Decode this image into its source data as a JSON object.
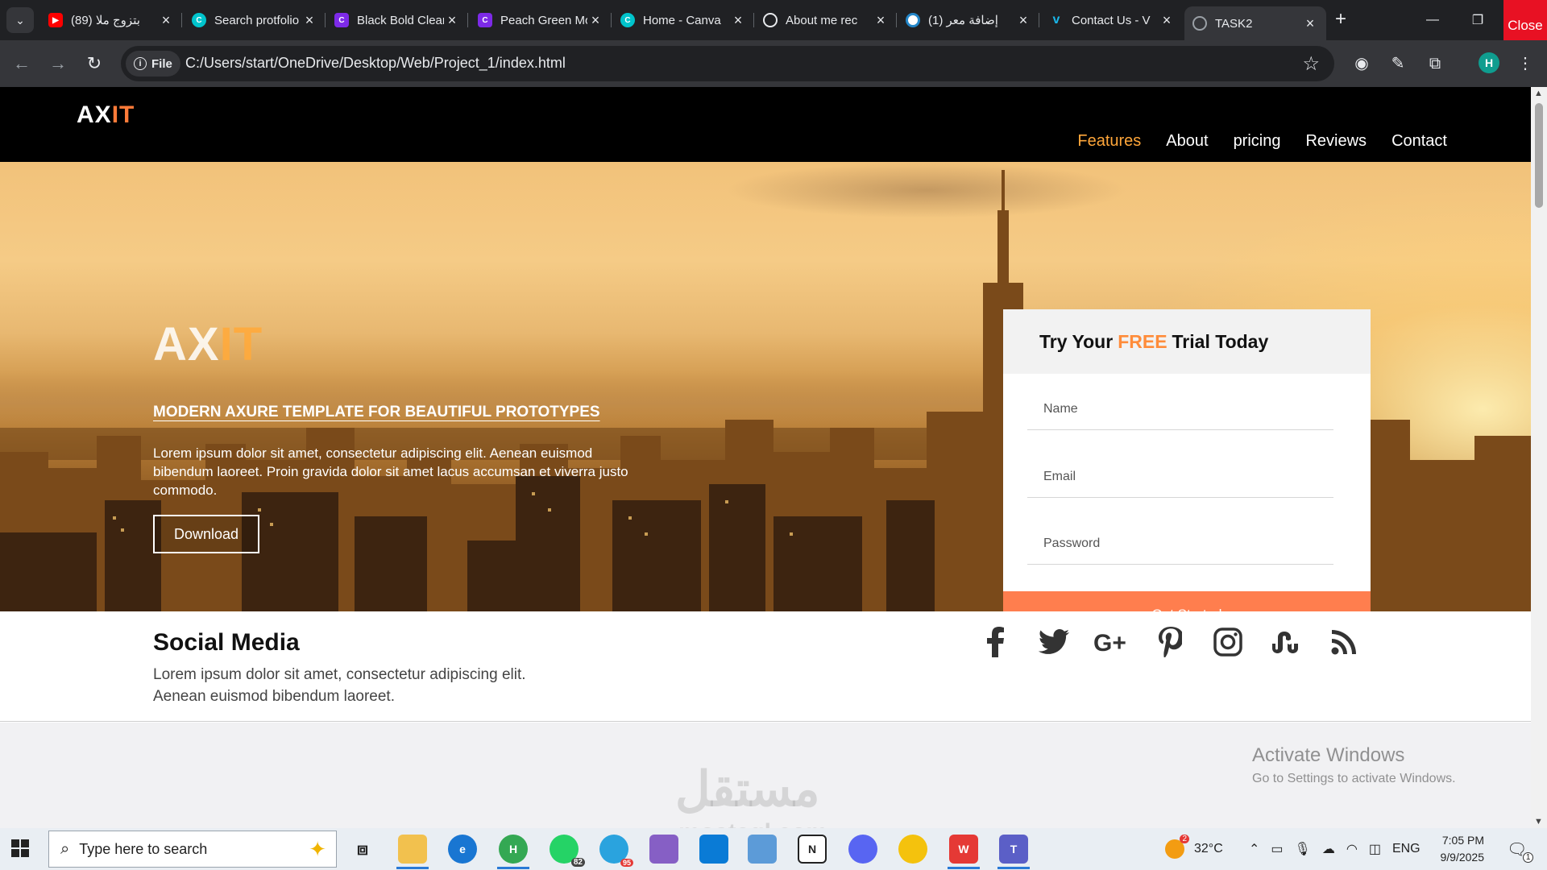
{
  "browser": {
    "tabs": [
      {
        "title": "(89) بتزوج ملا",
        "favicon": "youtube-icon",
        "color": "#ff0000"
      },
      {
        "title": "Search protfolio",
        "favicon": "canva-icon",
        "color": "#00c4cc"
      },
      {
        "title": "Black Bold Clean",
        "favicon": "canva-doc-icon",
        "color": "#7d2ae8"
      },
      {
        "title": "Peach Green Mod",
        "favicon": "canva-doc-icon",
        "color": "#7d2ae8"
      },
      {
        "title": "Home - Canva",
        "favicon": "canva-icon",
        "color": "#00c4cc"
      },
      {
        "title": "About me rec",
        "favicon": "chatgpt-icon",
        "color": "#202124"
      },
      {
        "title": "إضافة معر (1)",
        "favicon": "mostaql-icon",
        "color": "#ffffff"
      },
      {
        "title": "Contact Us - V",
        "favicon": "vimeo-icon",
        "color": "#1ab7ea"
      },
      {
        "title": "TASK2",
        "favicon": "globe-icon",
        "color": "#5f6368"
      }
    ],
    "close_label": "Close",
    "file_chip": "File",
    "url": "C:/Users/start/OneDrive/Desktop/Web/Project_1/index.html",
    "profile_initial": "H"
  },
  "site": {
    "logo": {
      "part1": "AX",
      "part2": "IT"
    },
    "nav": [
      "Features",
      "About",
      "pricing",
      "Reviews",
      "Contact"
    ],
    "hero": {
      "title": {
        "part1": "AX",
        "part2": "IT"
      },
      "subtitle": "MODERN AXURE TEMPLATE FOR BEAUTIFUL PROTOTYPES",
      "text": "Lorem ipsum dolor sit amet, consectetur adipiscing elit. Aenean euismod bibendum laoreet. Proin gravida dolor sit amet lacus accumsan et viverra justo commodo.",
      "button": "Download"
    },
    "trial": {
      "title_before": "Try Your",
      "title_free": "FREE",
      "title_after": "Trial Today",
      "name_placeholder": "Name",
      "email_placeholder": "Email",
      "password_placeholder": "Password",
      "button": "Get Started"
    },
    "social": {
      "title": "Social Media",
      "line1": "Lorem ipsum dolor sit amet, consectetur adipiscing elit.",
      "line2": "Aenean euismod bibendum laoreet.",
      "icons": [
        "facebook-icon",
        "twitter-icon",
        "google-plus-icon",
        "pinterest-icon",
        "instagram-icon",
        "stumbleupon-icon",
        "rss-icon"
      ]
    },
    "accent_color": "#ff7b39",
    "button_color": "#ff7e4e"
  },
  "watermark": {
    "arabic": "مستقل",
    "latin": "mostaql.com"
  },
  "windows": {
    "activate_title": "Activate Windows",
    "activate_text": "Go to Settings to activate Windows."
  },
  "taskbar": {
    "search_placeholder": "Type here to search",
    "whatsapp_badge": "82",
    "telegram_badge": "95",
    "weather_badge": "2",
    "temperature": "32°C",
    "language": "ENG",
    "time": "7:05 PM",
    "date": "9/9/2025",
    "notifications_badge": "1"
  }
}
